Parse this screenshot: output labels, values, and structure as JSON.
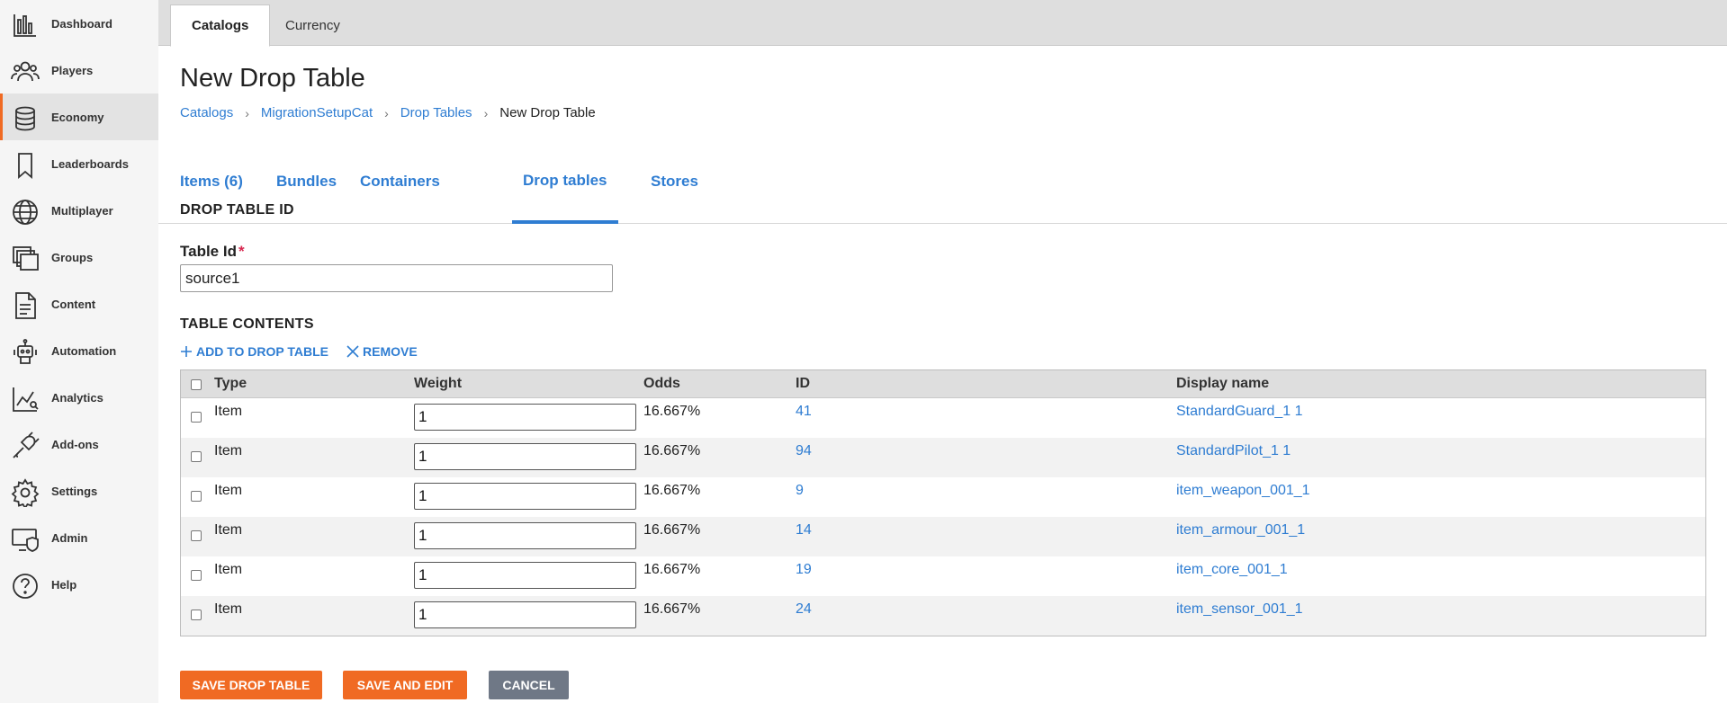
{
  "sidebar": {
    "items": [
      {
        "label": "Dashboard",
        "icon": "dashboard-icon",
        "active": false
      },
      {
        "label": "Players",
        "icon": "players-icon",
        "active": false
      },
      {
        "label": "Economy",
        "icon": "economy-icon",
        "active": true
      },
      {
        "label": "Leaderboards",
        "icon": "leaderboards-icon",
        "active": false
      },
      {
        "label": "Multiplayer",
        "icon": "globe-icon",
        "active": false
      },
      {
        "label": "Groups",
        "icon": "groups-icon",
        "active": false
      },
      {
        "label": "Content",
        "icon": "content-icon",
        "active": false
      },
      {
        "label": "Automation",
        "icon": "robot-icon",
        "active": false
      },
      {
        "label": "Analytics",
        "icon": "analytics-icon",
        "active": false
      },
      {
        "label": "Add-ons",
        "icon": "plug-icon",
        "active": false
      },
      {
        "label": "Settings",
        "icon": "gear-icon",
        "active": false
      },
      {
        "label": "Admin",
        "icon": "admin-icon",
        "active": false
      },
      {
        "label": "Help",
        "icon": "help-icon",
        "active": false
      }
    ]
  },
  "top_tabs": [
    {
      "label": "Catalogs",
      "active": true
    },
    {
      "label": "Currency",
      "active": false
    }
  ],
  "page": {
    "title": "New Drop Table",
    "breadcrumb": [
      "Catalogs",
      "MigrationSetupCat",
      "Drop Tables"
    ],
    "breadcrumb_current": "New Drop Table"
  },
  "sub_tabs": [
    {
      "label": "Items (6)",
      "active": false
    },
    {
      "label": "Bundles",
      "active": false
    },
    {
      "label": "Containers",
      "active": false
    },
    {
      "label": "Drop tables",
      "active": true
    },
    {
      "label": "Stores",
      "active": false
    }
  ],
  "form": {
    "section_id": "DROP TABLE ID",
    "table_id_label": "Table Id",
    "required_mark": "*",
    "table_id_value": "source1",
    "section_contents": "TABLE CONTENTS",
    "add_label": "ADD TO DROP TABLE",
    "remove_label": "REMOVE"
  },
  "table": {
    "headers": {
      "type": "Type",
      "weight": "Weight",
      "odds": "Odds",
      "id": "ID",
      "display_name": "Display name"
    },
    "rows": [
      {
        "type": "Item",
        "weight": "1",
        "odds": "16.667%",
        "id": "41",
        "display_name": "StandardGuard_1 1"
      },
      {
        "type": "Item",
        "weight": "1",
        "odds": "16.667%",
        "id": "94",
        "display_name": "StandardPilot_1 1"
      },
      {
        "type": "Item",
        "weight": "1",
        "odds": "16.667%",
        "id": "9",
        "display_name": "item_weapon_001_1"
      },
      {
        "type": "Item",
        "weight": "1",
        "odds": "16.667%",
        "id": "14",
        "display_name": "item_armour_001_1"
      },
      {
        "type": "Item",
        "weight": "1",
        "odds": "16.667%",
        "id": "19",
        "display_name": "item_core_001_1"
      },
      {
        "type": "Item",
        "weight": "1",
        "odds": "16.667%",
        "id": "24",
        "display_name": "item_sensor_001_1"
      }
    ]
  },
  "buttons": {
    "save": "SAVE DROP TABLE",
    "save_edit": "SAVE AND EDIT",
    "cancel": "CANCEL"
  },
  "colors": {
    "accent": "#f06a23",
    "link": "#2f7dd2",
    "cancel": "#6f7886"
  }
}
